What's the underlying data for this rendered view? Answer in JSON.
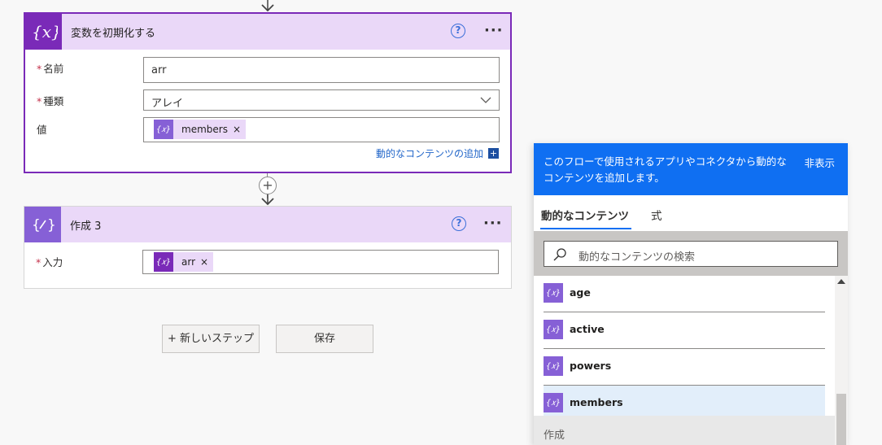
{
  "card1": {
    "title": "変数を初期化する",
    "help": "?",
    "more": "···",
    "fields": [
      {
        "label": "名前",
        "required": true,
        "value": "arr"
      },
      {
        "label": "種類",
        "required": true,
        "value": "アレイ"
      },
      {
        "label": "値",
        "required": false,
        "token": "members",
        "token_close": "×"
      }
    ],
    "add_dynamic": "動的なコンテンツの追加",
    "add_dynamic_icon": "+"
  },
  "card2": {
    "title": "作成 3",
    "help": "?",
    "more": "···",
    "input_label": "入力",
    "token": "arr",
    "token_close": "×"
  },
  "connector_plus": "+",
  "buttons": {
    "new_step": "+ 新しいステップ",
    "save": "保存"
  },
  "panel": {
    "description": "このフローで使用されるアプリやコネクタから動的なコンテンツを追加します。",
    "hide": "非表示",
    "tabs": [
      "動的なコンテンツ",
      "式"
    ],
    "search_placeholder": "動的なコンテンツの検索",
    "items": [
      "age",
      "active",
      "powers",
      "members"
    ],
    "section": "作成"
  },
  "colors": {
    "accent_purple": "#7a2ab8",
    "variable_purple": "#8660d6",
    "panel_blue": "#0f6ff2"
  },
  "icons": [
    "variable-icon",
    "compose-icon",
    "help-icon",
    "more-icon",
    "chevron-down-icon",
    "search-icon",
    "close-icon",
    "arrow-down-icon"
  ]
}
